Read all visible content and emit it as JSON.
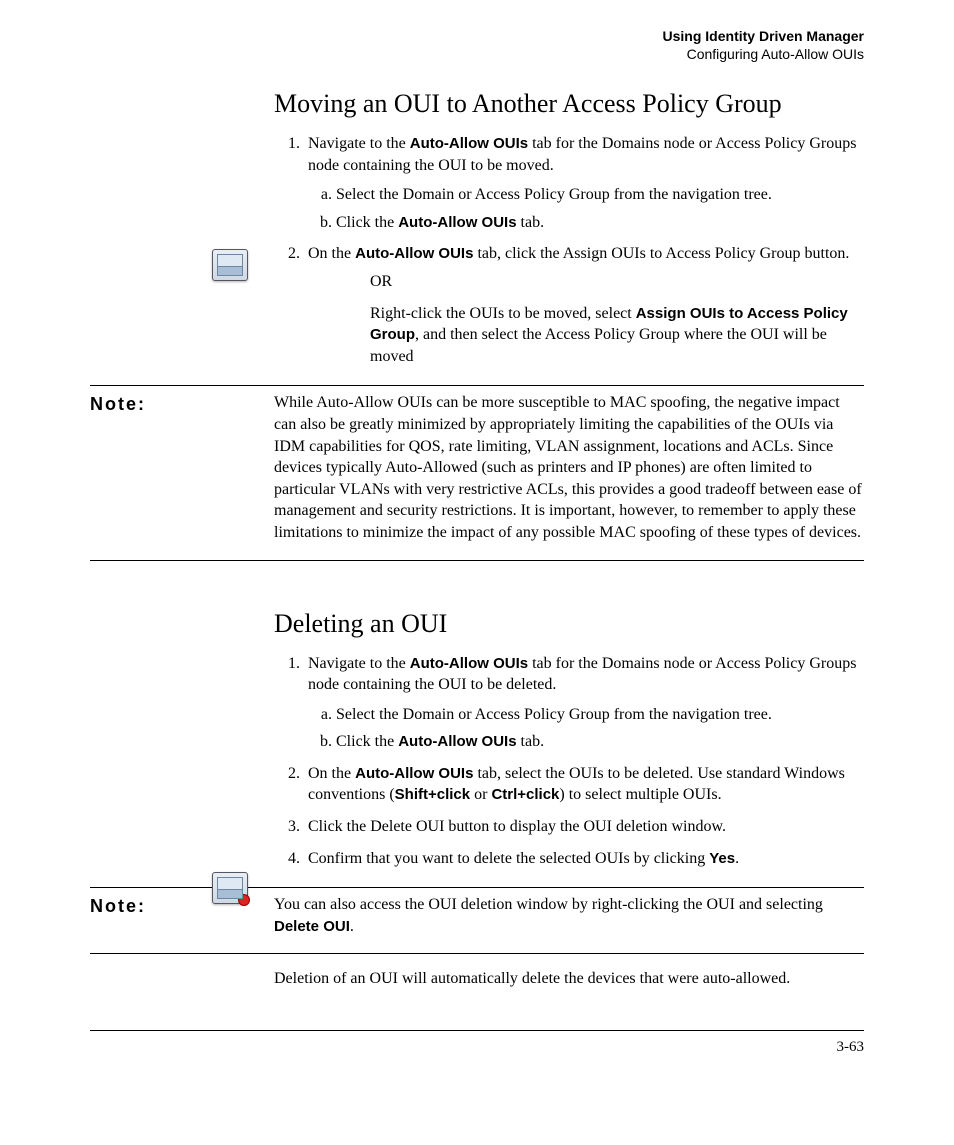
{
  "header": {
    "line1": "Using Identity Driven Manager",
    "line2": "Configuring Auto-Allow OUIs"
  },
  "section1": {
    "title": "Moving an OUI to Another Access Policy Group",
    "step1_pre": "Navigate to the ",
    "step1_bold": "Auto-Allow OUIs",
    "step1_post": " tab for the Domains node or Access Policy Groups node containing the OUI to be moved.",
    "step1a": "Select the Domain or Access Policy Group from the navigation tree.",
    "step1b_pre": "Click the ",
    "step1b_bold": "Auto-Allow OUIs",
    "step1b_post": " tab.",
    "step2_pre": "On the ",
    "step2_bold": "Auto-Allow OUIs",
    "step2_post": " tab, click the Assign OUIs to Access Policy Group button.",
    "or": "OR",
    "alt_pre": "Right-click the OUIs to be moved, select ",
    "alt_bold": "Assign OUIs to Access Policy Group",
    "alt_post": ", and then select the Access Policy Group where the OUI will be moved"
  },
  "note1": {
    "label": "Note:",
    "body": "While Auto-Allow OUIs can be more susceptible to MAC spoofing, the negative impact can also be greatly minimized by appropriately limiting the capabilities of the OUIs via IDM capabilities for QOS, rate limiting, VLAN assignment, locations and ACLs. Since devices typically Auto-Allowed (such as printers and IP phones) are often limited to particular VLANs with very restrictive ACLs, this provides a good tradeoff between ease of management and security restrictions. It is important, however, to remember to apply these limitations to minimize the impact of any possible MAC spoofing of these types of devices."
  },
  "section2": {
    "title": "Deleting an OUI",
    "step1_pre": "Navigate to the ",
    "step1_bold": "Auto-Allow OUIs",
    "step1_post": " tab for the Domains node or Access Policy Groups node containing the OUI to be deleted.",
    "step1a": "Select the Domain or Access Policy Group from the navigation tree.",
    "step1b_pre": "Click the ",
    "step1b_bold": "Auto-Allow OUIs",
    "step1b_post": " tab.",
    "step2_pre": "On the ",
    "step2_bold1": "Auto-Allow OUIs",
    "step2_mid": " tab, select the OUIs to be deleted. Use standard Windows conventions (",
    "step2_bold2": "Shift+click",
    "step2_mid2": " or ",
    "step2_bold3": "Ctrl+click",
    "step2_post": ") to select multiple OUIs.",
    "step3": " Click the Delete OUI button to display the OUI deletion window.",
    "step4_pre": "Confirm that you want to delete the selected OUIs by clicking ",
    "step4_bold": "Yes",
    "step4_post": "."
  },
  "note2": {
    "label": "Note:",
    "body_pre": "You can also access the OUI deletion window by right-clicking the OUI and selecting ",
    "body_bold": "Delete OUI",
    "body_post": "."
  },
  "after_note2": "Deletion of an OUI will automatically delete the devices that were auto-allowed.",
  "page_number": "3-63"
}
